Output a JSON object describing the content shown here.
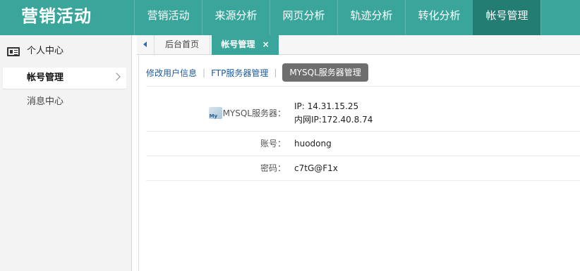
{
  "app": {
    "title": "营销活动"
  },
  "nav": {
    "items": [
      {
        "label": "营销活动"
      },
      {
        "label": "来源分析"
      },
      {
        "label": "网页分析"
      },
      {
        "label": "轨迹分析"
      },
      {
        "label": "转化分析"
      },
      {
        "label": "帐号管理",
        "active": true
      }
    ]
  },
  "sidebar": {
    "section_title": "个人中心",
    "items": [
      {
        "label": "帐号管理",
        "active": true
      },
      {
        "label": "消息中心"
      }
    ]
  },
  "tabs": {
    "home": "后台首页",
    "current": "帐号管理",
    "close_glyph": "×"
  },
  "subnav": {
    "links": [
      "修改用户信息",
      "FTP服务器管理"
    ],
    "separator": "|",
    "active": "MYSQL服务器管理"
  },
  "server_info": {
    "server_label": "MYSQL服务器：",
    "ip": "IP: 14.31.15.25",
    "internal_ip": "内网IP:172.40.8.74",
    "account_label": "账号：",
    "account_value": "huodong",
    "password_label": "密码：",
    "password_value": "c7tG@F1x"
  },
  "colors": {
    "brand": "#3aa69b",
    "nav_active": "#237d73",
    "link": "#1d5a9e",
    "pill": "#6e6e6e"
  },
  "icons": {
    "sidebar_section": "id-card-icon",
    "sidebar_active_item": "chevron-right-icon",
    "tab_scroll": "triangle-left-icon",
    "server": "mysql-logo-icon"
  }
}
